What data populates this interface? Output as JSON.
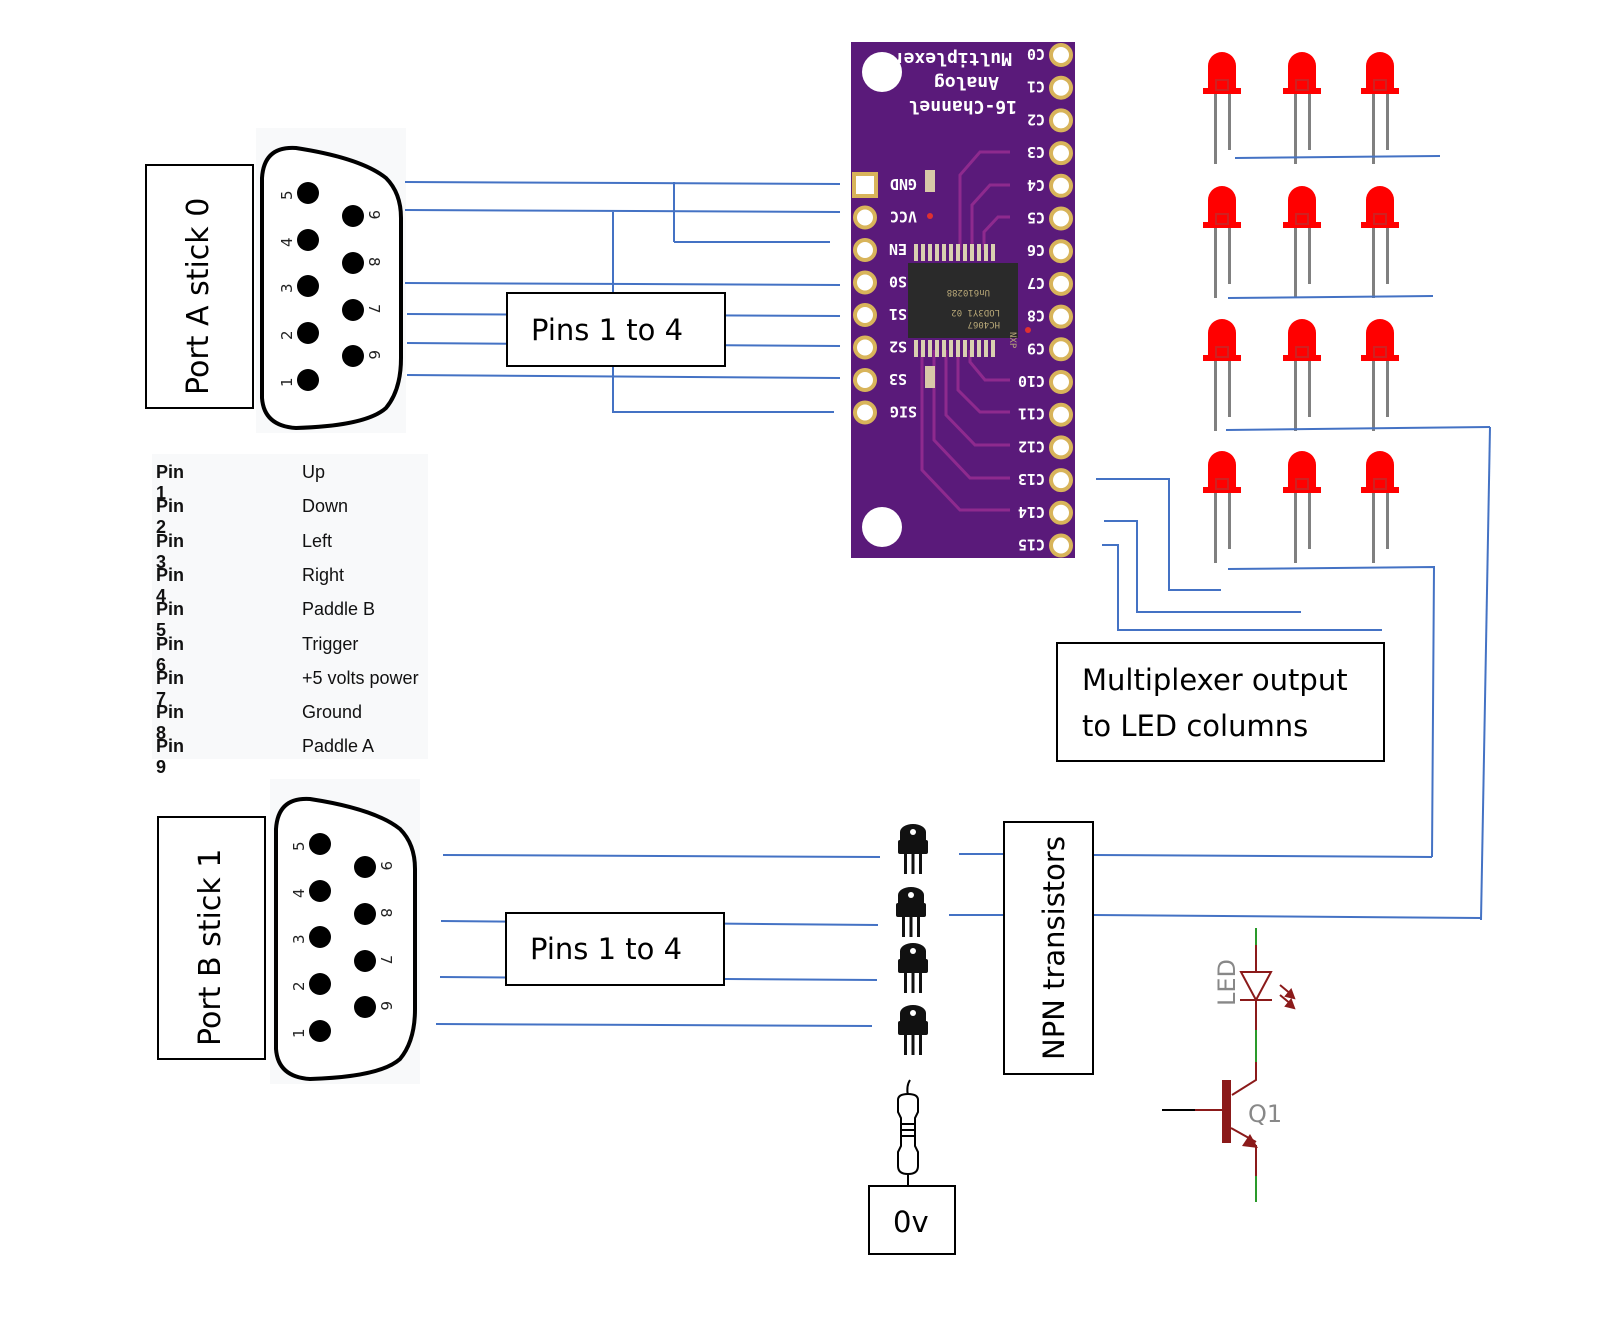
{
  "labels": {
    "port_a": "Port A stick 0",
    "port_b": "Port B stick 1",
    "pins_a": "Pins 1 to 4",
    "pins_b": "Pins 1 to 4",
    "mux_output_line1": "Multiplexer output",
    "mux_output_line2": "to LED columns",
    "npn": "NPN transistors",
    "ground": "0v"
  },
  "db9_connector": {
    "top_row_pins": [
      "5",
      "4",
      "3",
      "2",
      "1"
    ],
    "bottom_row_pins": [
      "9",
      "8",
      "7",
      "6"
    ]
  },
  "pin_table": [
    {
      "pin": "Pin 1",
      "function": "Up"
    },
    {
      "pin": "Pin 2",
      "function": "Down"
    },
    {
      "pin": "Pin 3",
      "function": "Left"
    },
    {
      "pin": "Pin 4",
      "function": "Right"
    },
    {
      "pin": "Pin 5",
      "function": "Paddle B"
    },
    {
      "pin": "Pin 6",
      "function": "Trigger"
    },
    {
      "pin": "Pin 7",
      "function": "+5 volts power"
    },
    {
      "pin": "Pin 8",
      "function": "Ground"
    },
    {
      "pin": "Pin 9",
      "function": "Paddle A"
    }
  ],
  "multiplexer_board": {
    "title_lines": [
      "Multiplexer",
      "Analog",
      "16-Channel"
    ],
    "chip_lines": [
      "HC4067",
      "LOD3Y1 02",
      "Un610288",
      "NXP"
    ],
    "left_pins": [
      "GND",
      "VCC",
      "EN",
      "S0",
      "S1",
      "S2",
      "S3",
      "SIG"
    ],
    "right_pins": [
      "C0",
      "C1",
      "C2",
      "C3",
      "C4",
      "C5",
      "C6",
      "C7",
      "C8",
      "C9",
      "C10",
      "C11",
      "C12",
      "C13",
      "C14",
      "C15"
    ],
    "board_color": "#5a1a7a",
    "trace_color": "#8e2a8e",
    "pad_color": "#d8b45a"
  },
  "led_matrix": {
    "rows": 4,
    "columns": 3,
    "led_color": "#ff0000",
    "leg_color": "#808080"
  },
  "transistors": {
    "count": 4
  },
  "schematic": {
    "led_label": "LED",
    "transistor_label": "Q1",
    "symbol_color": "#8b1a1a",
    "wire_color": "#2a9a2a"
  },
  "colors": {
    "wire": "#4472C4",
    "box_border": "#000000"
  }
}
